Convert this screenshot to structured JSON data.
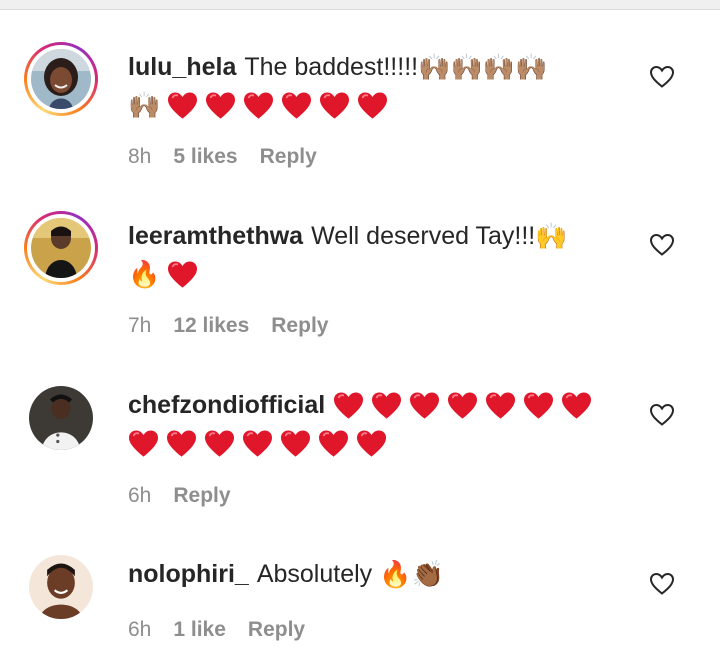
{
  "comments": [
    {
      "username": "lulu_hela",
      "text": "The baddest!!!!!",
      "emojis_line1": "🙌🏽🙌🏽🙌🏽🙌🏽",
      "emojis_line2_prefix": "🙌🏽",
      "hearts": 6,
      "time": "8h",
      "likes": "5 likes",
      "reply": "Reply",
      "story_ring": true
    },
    {
      "username": "leeramthethwa",
      "text": "Well deserved Tay!!!",
      "emojis_line1": "🙌",
      "emojis_line2_prefix": "🔥",
      "hearts": 1,
      "time": "7h",
      "likes": "12 likes",
      "reply": "Reply",
      "story_ring": true
    },
    {
      "username": "chefzondiofficial",
      "text": "",
      "hearts_line1": 7,
      "hearts_line2": 7,
      "time": "6h",
      "likes": "",
      "reply": "Reply",
      "story_ring": false
    },
    {
      "username": "nolophiri_",
      "text": "Absolutely",
      "emojis_line1": "🔥👏🏾",
      "time": "6h",
      "likes": "1 like",
      "reply": "Reply",
      "story_ring": false
    }
  ],
  "icons": {
    "like": "heart-outline-icon",
    "emoji_heart": "red-heart-emoji"
  },
  "colors": {
    "text": "#262626",
    "meta": "#8e8e8e",
    "heart": "#e0162b"
  }
}
